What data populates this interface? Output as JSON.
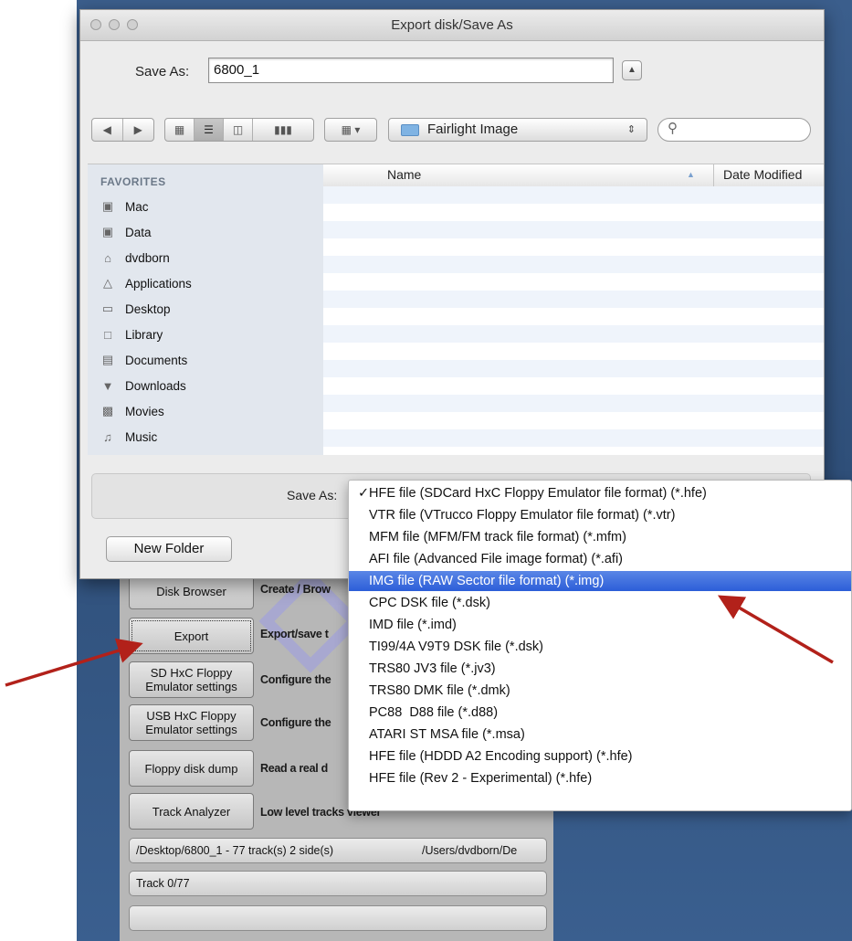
{
  "dialog": {
    "title": "Export disk/Save As",
    "save_as_label": "Save As:",
    "filename": "6800_1",
    "location": "Fairlight Image",
    "search_placeholder": "",
    "new_folder_label": "New Folder",
    "format_label": "Save As:"
  },
  "sidebar": {
    "header": "FAVORITES",
    "items": [
      {
        "label": "Mac",
        "icon": "disk-icon"
      },
      {
        "label": "Data",
        "icon": "disk-icon"
      },
      {
        "label": "dvdborn",
        "icon": "home-icon"
      },
      {
        "label": "Applications",
        "icon": "applications-icon"
      },
      {
        "label": "Desktop",
        "icon": "desktop-icon"
      },
      {
        "label": "Library",
        "icon": "folder-icon"
      },
      {
        "label": "Documents",
        "icon": "documents-icon"
      },
      {
        "label": "Downloads",
        "icon": "downloads-icon"
      },
      {
        "label": "Movies",
        "icon": "movies-icon"
      },
      {
        "label": "Music",
        "icon": "music-icon"
      }
    ]
  },
  "filelist": {
    "columns": [
      "Name",
      "Date Modified"
    ]
  },
  "format_menu": {
    "checked_index": 0,
    "selected_index": 4,
    "items": [
      "HFE file (SDCard HxC Floppy Emulator file format) (*.hfe)",
      "VTR file (VTrucco Floppy Emulator file format) (*.vtr)",
      "MFM file (MFM/FM track file format) (*.mfm)",
      "AFI file (Advanced File image format) (*.afi)",
      "IMG file (RAW Sector file format) (*.img)",
      "CPC DSK file (*.dsk)",
      "IMD file (*.imd)",
      "TI99/4A V9T9 DSK file (*.dsk)",
      "TRS80 JV3 file (*.jv3)",
      "TRS80 DMK file (*.dmk)",
      "PC88  D88 file (*.d88)",
      "ATARI ST MSA file (*.msa)",
      "HFE file (HDDD A2 Encoding support) (*.hfe)",
      "HFE file (Rev 2 - Experimental) (*.hfe)"
    ]
  },
  "app": {
    "buttons": [
      {
        "label": "Disk Browser",
        "desc": "Create / Brow"
      },
      {
        "label": "Export",
        "desc": "Export/save t"
      },
      {
        "label": "SD HxC Floppy Emulator settings",
        "desc": "Configure the"
      },
      {
        "label": "USB HxC Floppy Emulator settings",
        "desc": "Configure the"
      },
      {
        "label": "Floppy disk dump",
        "desc": "Read a real d"
      },
      {
        "label": "Track Analyzer",
        "desc": "Low level tracks viewer"
      }
    ],
    "status_file": "/Desktop/6800_1 - 77 track(s) 2 side(s)",
    "status_path": "/Users/dvdborn/De",
    "status_track": "Track 0/77"
  },
  "colors": {
    "menu_highlight": "#2c5ed8",
    "arrow": "#b2211a",
    "sidebar_bg": "#e2e7ee"
  }
}
